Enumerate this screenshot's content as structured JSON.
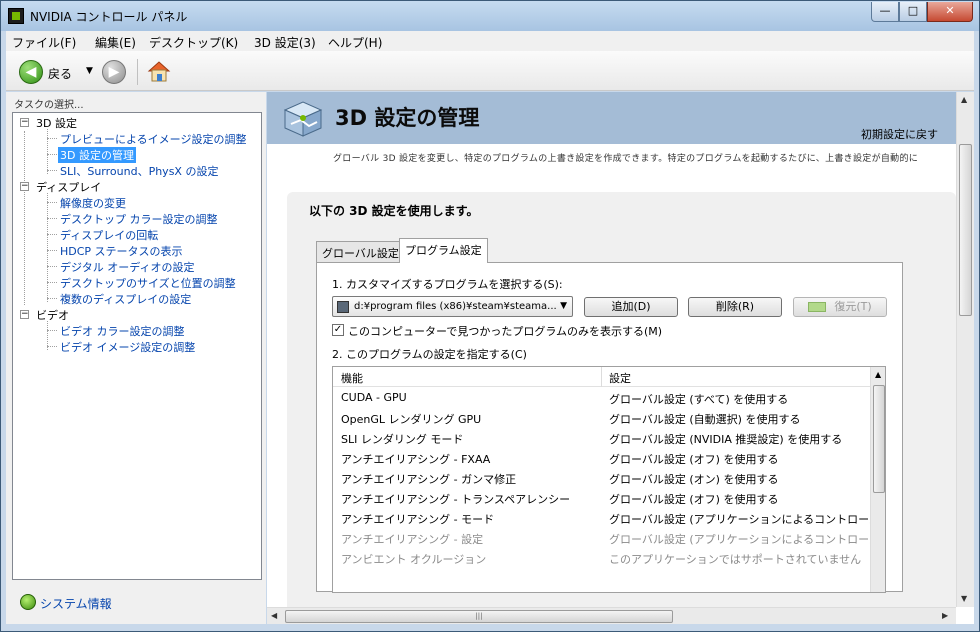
{
  "window": {
    "title": "NVIDIA コントロール パネル",
    "minimize": "—",
    "maximize": "□",
    "close": "✕"
  },
  "menu": [
    "ファイル(F)",
    "編集(E)",
    "デスクトップ(K)",
    "3D 設定(3)",
    "ヘルプ(H)"
  ],
  "toolbar": {
    "back_label": "戻る",
    "back_glyph": "◀",
    "fwd_glyph": "▶",
    "dropdown_glyph": "▼"
  },
  "sidebar": {
    "header": "タスクの選択...",
    "tree": [
      {
        "label": "3D 設定",
        "level": 0,
        "expander": "−"
      },
      {
        "label": "プレビューによるイメージ設定の調整",
        "level": 1
      },
      {
        "label": "3D 設定の管理",
        "level": 1,
        "selected": true
      },
      {
        "label": "SLI、Surround、PhysX の設定",
        "level": 1
      },
      {
        "label": "ディスプレイ",
        "level": 0,
        "expander": "−"
      },
      {
        "label": "解像度の変更",
        "level": 1
      },
      {
        "label": "デスクトップ カラー設定の調整",
        "level": 1
      },
      {
        "label": "ディスプレイの回転",
        "level": 1
      },
      {
        "label": "HDCP ステータスの表示",
        "level": 1
      },
      {
        "label": "デジタル オーディオの設定",
        "level": 1
      },
      {
        "label": "デスクトップのサイズと位置の調整",
        "level": 1
      },
      {
        "label": "複数のディスプレイの設定",
        "level": 1
      },
      {
        "label": "ビデオ",
        "level": 0,
        "expander": "−"
      },
      {
        "label": "ビデオ カラー設定の調整",
        "level": 1
      },
      {
        "label": "ビデオ イメージ設定の調整",
        "level": 1
      }
    ],
    "system_info": "システム情報"
  },
  "main": {
    "title": "3D 設定の管理",
    "restore_defaults": "初期設定に戻す",
    "description": "グローバル 3D 設定を変更し、特定のプログラムの上書き設定を作成できます。特定のプログラムを起動するたびに、上書き設定が自動的に",
    "heading": "以下の 3D 設定を使用します。",
    "tabs": [
      {
        "label": "グローバル設定",
        "active": false
      },
      {
        "label": "プログラム設定",
        "active": true
      }
    ],
    "step1": "1. カスタマイズするプログラムを選択する(S):",
    "program_value": "d:¥program files (x86)¥steam¥steama...",
    "add_button": "追加(D)",
    "remove_button": "削除(R)",
    "restore_button": "復元(T)",
    "checkbox_label": "このコンピューターで見つかったプログラムのみを表示する(M)",
    "checkbox_checked": "✓",
    "step2": "2. このプログラムの設定を指定する(C)",
    "grid": {
      "columns": [
        "機能",
        "設定"
      ],
      "rows": [
        {
          "feature": "CUDA - GPU",
          "setting": "グローバル設定 (すべて) を使用する",
          "dim": false
        },
        {
          "feature": "OpenGL レンダリング GPU",
          "setting": "グローバル設定 (自動選択) を使用する",
          "dim": false
        },
        {
          "feature": "SLI レンダリング モード",
          "setting": "グローバル設定 (NVIDIA 推奨設定) を使用する",
          "dim": false
        },
        {
          "feature": "アンチエイリアシング - FXAA",
          "setting": "グローバル設定 (オフ) を使用する",
          "dim": false
        },
        {
          "feature": "アンチエイリアシング - ガンマ修正",
          "setting": "グローバル設定 (オン) を使用する",
          "dim": false
        },
        {
          "feature": "アンチエイリアシング - トランスペアレンシー",
          "setting": "グローバル設定 (オフ) を使用する",
          "dim": false
        },
        {
          "feature": "アンチエイリアシング - モード",
          "setting": "グローバル設定 (アプリケーションによるコントロール) ...",
          "dim": false
        },
        {
          "feature": "アンチエイリアシング - 設定",
          "setting": "グローバル設定 (アプリケーションによるコントロール) ...",
          "dim": true
        },
        {
          "feature": "アンビエント オクルージョン",
          "setting": "このアプリケーションではサポートされていません",
          "dim": true
        }
      ]
    }
  },
  "scroll_glyphs": {
    "up": "▲",
    "down": "▼",
    "left": "◀",
    "right": "▶",
    "grip": "|||"
  }
}
